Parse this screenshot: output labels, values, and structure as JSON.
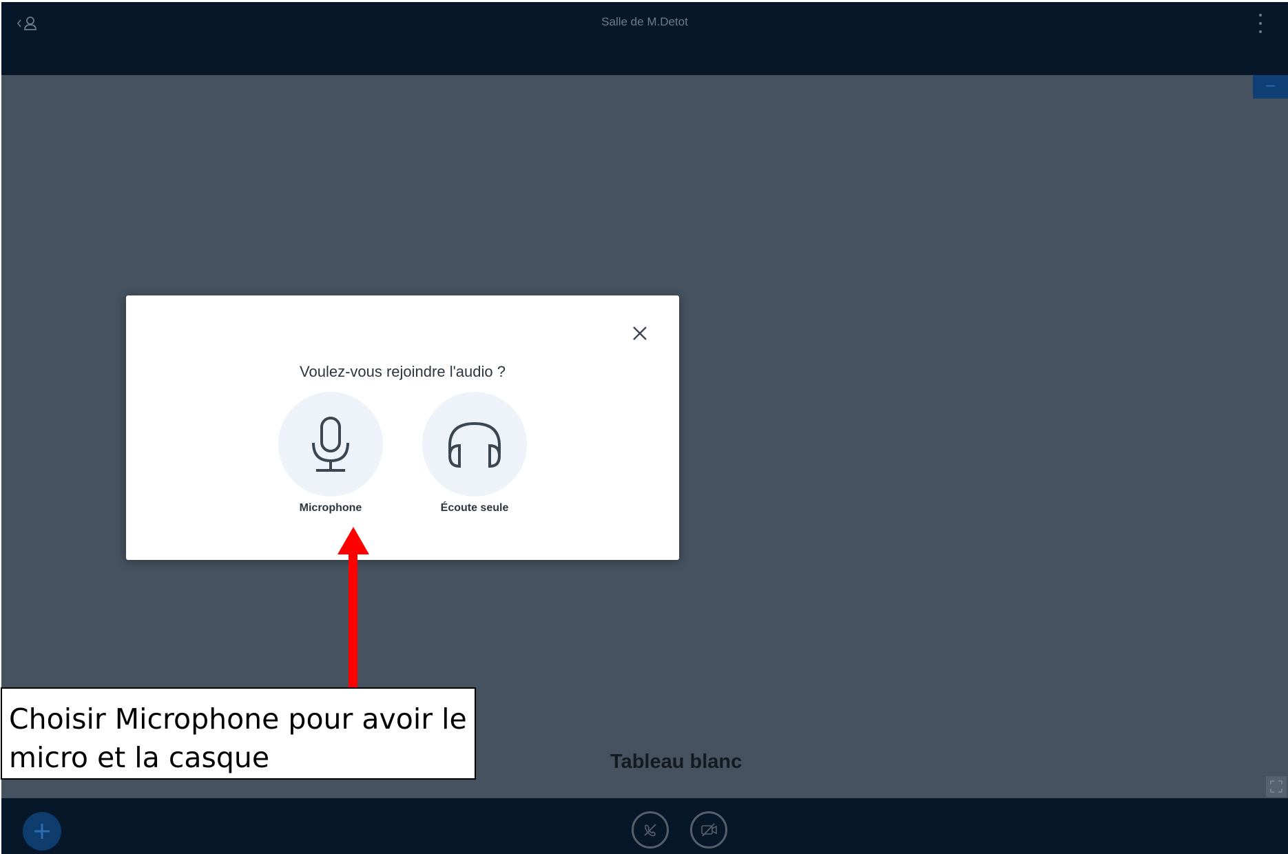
{
  "app": {
    "room_title": "Salle de M.Detot",
    "whiteboard_title": "Tableau blanc"
  },
  "topbar": {
    "user_list_icon": "user-icon",
    "options_icon": "kebab-menu-icon"
  },
  "modal": {
    "title": "Voulez-vous rejoindre l'audio ?",
    "close_icon": "close-icon",
    "options": [
      {
        "label": "Microphone",
        "icon": "microphone-icon"
      },
      {
        "label": "Écoute seule",
        "icon": "headphones-icon"
      }
    ]
  },
  "bottombar": {
    "actions_icon": "plus-icon",
    "join_audio_icon": "phone-off-icon",
    "webcam_icon": "video-off-icon"
  },
  "annotation": {
    "text": "Choisir Microphone pour avoir le micro et la casque",
    "arrow_color": "#ff0000"
  },
  "colors": {
    "topbar": "#06172a",
    "stage": "#46525f",
    "accent": "#0d3c6d"
  }
}
